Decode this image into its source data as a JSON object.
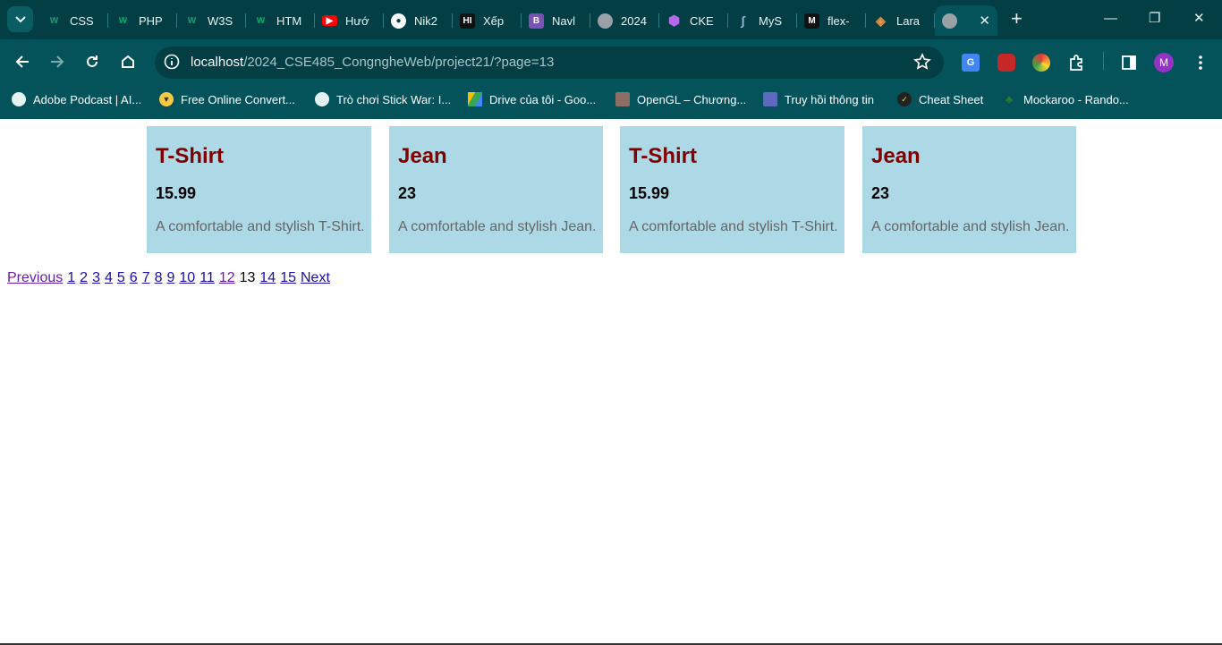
{
  "browser": {
    "tabs": [
      {
        "title": "CSS",
        "icon": "w3schools-icon",
        "color": "#04aa6d"
      },
      {
        "title": "PHP",
        "icon": "w3schools-icon",
        "color": "#04aa6d"
      },
      {
        "title": "W3S",
        "icon": "w3schools-icon",
        "color": "#04aa6d"
      },
      {
        "title": "HTM",
        "icon": "w3schools-icon",
        "color": "#04aa6d"
      },
      {
        "title": "Hướ",
        "icon": "youtube-icon",
        "color": "#ff0000"
      },
      {
        "title": "Nik2",
        "icon": "github-icon",
        "color": "#ffffff"
      },
      {
        "title": "Xếp",
        "icon": "hi-icon",
        "color": "#111111"
      },
      {
        "title": "Navl",
        "icon": "bootstrap-icon",
        "color": "#7952b3"
      },
      {
        "title": "2024",
        "icon": "globe-icon",
        "color": "#9aa0a6"
      },
      {
        "title": "CKE",
        "icon": "ckeditor-icon",
        "color": "#8f3bd6"
      },
      {
        "title": "MyS",
        "icon": "mysql-icon",
        "color": "#4479a1"
      },
      {
        "title": "flex-",
        "icon": "medium-icon",
        "color": "#111111"
      },
      {
        "title": "Lara",
        "icon": "laravel-icon",
        "color": "#f05340"
      }
    ],
    "active_tab_icon": "globe-icon",
    "url_host": "localhost",
    "url_path": "/2024_CSE485_CongngheWeb/project21/?page=13",
    "bookmarks": [
      {
        "label": "Adobe Podcast | AI..."
      },
      {
        "label": "Free Online Convert..."
      },
      {
        "label": "Trò chơi Stick War: I..."
      },
      {
        "label": "Drive của tôi - Goo..."
      },
      {
        "label": "OpenGL – Chương..."
      },
      {
        "label": "Truy hồi thông tin"
      },
      {
        "label": "Cheat Sheet"
      },
      {
        "label": "Mockaroo - Rando..."
      }
    ],
    "profile_initial": "M",
    "colors": {
      "tabstrip": "#033e44",
      "toolbar": "#04535a",
      "profile": "#9334c4"
    }
  },
  "products": [
    {
      "name": "T-Shirt",
      "price": "15.99",
      "description": "A comfortable and stylish T-Shirt."
    },
    {
      "name": "Jean",
      "price": "23",
      "description": "A comfortable and stylish Jean."
    },
    {
      "name": "T-Shirt",
      "price": "15.99",
      "description": "A comfortable and stylish T-Shirt."
    },
    {
      "name": "Jean",
      "price": "23",
      "description": "A comfortable and stylish Jean."
    }
  ],
  "card_colors": {
    "background": "#add8e6",
    "title": "#800000",
    "description": "#666666"
  },
  "pagination": {
    "previous": "Previous",
    "pages": [
      "1",
      "2",
      "3",
      "4",
      "5",
      "6",
      "7",
      "8",
      "9",
      "10",
      "11",
      "12",
      "13",
      "14",
      "15"
    ],
    "current": "13",
    "next": "Next"
  }
}
